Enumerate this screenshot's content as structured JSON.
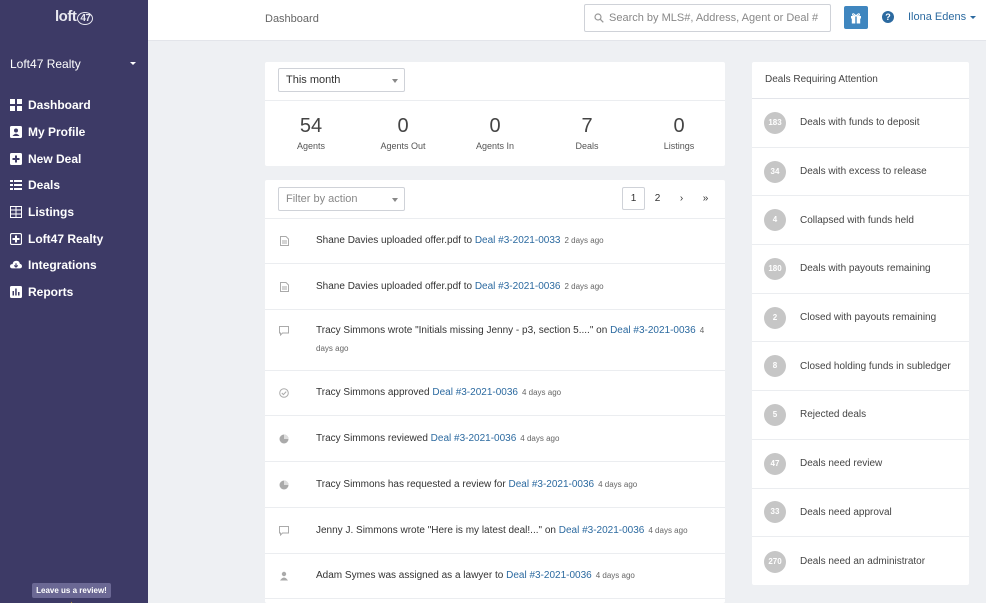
{
  "brand": {
    "logo_text": "loft",
    "logo_num": "47"
  },
  "sidebar": {
    "org_name": "Loft47 Realty",
    "items": [
      {
        "label": "Dashboard",
        "icon": "dashboard-icon"
      },
      {
        "label": "My Profile",
        "icon": "profile-icon"
      },
      {
        "label": "New Deal",
        "icon": "plus-square-icon"
      },
      {
        "label": "Deals",
        "icon": "list-icon"
      },
      {
        "label": "Listings",
        "icon": "building-icon"
      },
      {
        "label": "Loft47 Realty",
        "icon": "medical-square-icon"
      },
      {
        "label": "Integrations",
        "icon": "cloud-download-icon"
      },
      {
        "label": "Reports",
        "icon": "bar-chart-icon"
      }
    ],
    "review_label": "Leave us a review!",
    "review_star": "★"
  },
  "topbar": {
    "breadcrumb": "Dashboard",
    "search_placeholder": "Search by MLS#, Address, Agent or Deal #",
    "help_glyph": "?",
    "user_name": "Ilona Edens"
  },
  "stats": {
    "period": "This month",
    "items": [
      {
        "value": "54",
        "label": "Agents"
      },
      {
        "value": "0",
        "label": "Agents Out"
      },
      {
        "value": "0",
        "label": "Agents In"
      },
      {
        "value": "7",
        "label": "Deals"
      },
      {
        "value": "0",
        "label": "Listings"
      }
    ]
  },
  "activity": {
    "filter_placeholder": "Filter by action",
    "pages": [
      "1",
      "2",
      "›",
      "»"
    ],
    "rows": [
      {
        "icon": "file-icon",
        "text": "Shane Davies uploaded offer.pdf to ",
        "link": "Deal #3-2021-0033",
        "time": "2 days ago"
      },
      {
        "icon": "file-icon",
        "text": "Shane Davies uploaded offer.pdf to ",
        "link": "Deal #3-2021-0036",
        "time": "2 days ago"
      },
      {
        "icon": "comment-icon",
        "text": "Tracy Simmons wrote \"Initials missing Jenny - p3, section 5....\" on ",
        "link": "Deal #3-2021-0036",
        "time": "4 days ago"
      },
      {
        "icon": "check-circle-icon",
        "text": "Tracy Simmons approved ",
        "link": "Deal #3-2021-0036",
        "time": "4 days ago"
      },
      {
        "icon": "pie-icon",
        "text": "Tracy Simmons reviewed ",
        "link": "Deal #3-2021-0036",
        "time": "4 days ago"
      },
      {
        "icon": "pie-icon",
        "text": "Tracy Simmons has requested a review for ",
        "link": "Deal #3-2021-0036",
        "time": "4 days ago"
      },
      {
        "icon": "comment-icon",
        "text": "Jenny J. Simmons wrote \"Here is my latest deal!...\" on ",
        "link": "Deal #3-2021-0036",
        "time": "4 days ago"
      },
      {
        "icon": "user-icon",
        "text": "Adam Symes was assigned as a lawyer to ",
        "link": "Deal #3-2021-0036",
        "time": "4 days ago"
      }
    ]
  },
  "attention": {
    "title": "Deals Requiring Attention",
    "items": [
      {
        "count": "183",
        "label": "Deals with funds to deposit"
      },
      {
        "count": "34",
        "label": "Deals with excess to release"
      },
      {
        "count": "4",
        "label": "Collapsed with funds held"
      },
      {
        "count": "180",
        "label": "Deals with payouts remaining"
      },
      {
        "count": "2",
        "label": "Closed with payouts remaining"
      },
      {
        "count": "8",
        "label": "Closed holding funds in subledger"
      },
      {
        "count": "5",
        "label": "Rejected deals"
      },
      {
        "count": "47",
        "label": "Deals need review"
      },
      {
        "count": "33",
        "label": "Deals need approval"
      },
      {
        "count": "270",
        "label": "Deals need an administrator"
      }
    ]
  },
  "colors": {
    "sidebar": "#3d3a66",
    "accent": "#2c6aa0",
    "gift_button": "#3f86bf",
    "badge": "#c6c6c6"
  }
}
